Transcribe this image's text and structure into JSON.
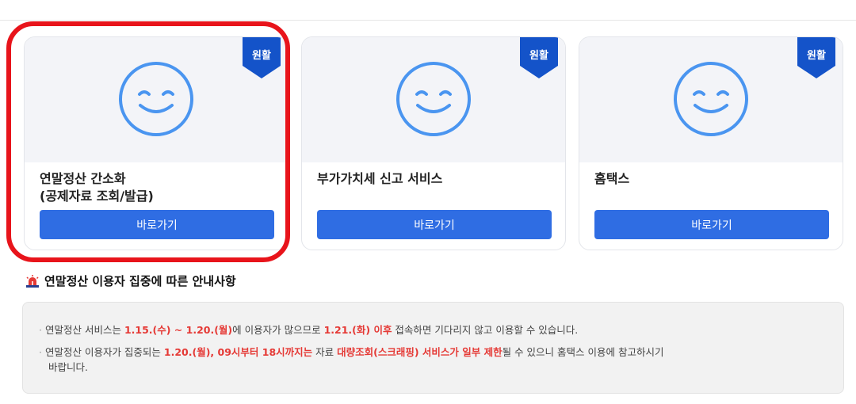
{
  "cards": [
    {
      "badge": "원활",
      "title_line1": "연말정산 간소화",
      "title_line2": "(공제자료 조회/발급)",
      "button": "바로가기"
    },
    {
      "badge": "원활",
      "title_line1": "부가가치세 신고 서비스",
      "title_line2": "",
      "button": "바로가기"
    },
    {
      "badge": "원활",
      "title_line1": "홈택스",
      "title_line2": "",
      "button": "바로가기"
    }
  ],
  "notice": {
    "title": "연말정산 이용자 집중에 따른 안내사항",
    "line1": {
      "t1": "연말정산 서비스는 ",
      "r1": "1.15.(수) ~ 1.20.(월)",
      "t2": "에 이용자가 많으므로 ",
      "r2": "1.21.(화) 이후",
      "t3": " 접속하면 기다리지 않고 이용할 수 있습니다."
    },
    "line2": {
      "t1": "연말정산 이용자가 집중되는 ",
      "r1": "1.20.(월), 09시부터 18시까지는",
      "t2": " 자료 ",
      "r2": "대량조회(스크래핑) 서비스가 일부 제한",
      "t3": "될 수 있으니 홈택스 이용에 참고하시기",
      "t4": "바랍니다."
    }
  },
  "colors": {
    "accent": "#2f6de3",
    "badge": "#1453c9",
    "highlight": "#e8141b",
    "notice_red": "#e53935",
    "face": "#4a95f0"
  }
}
